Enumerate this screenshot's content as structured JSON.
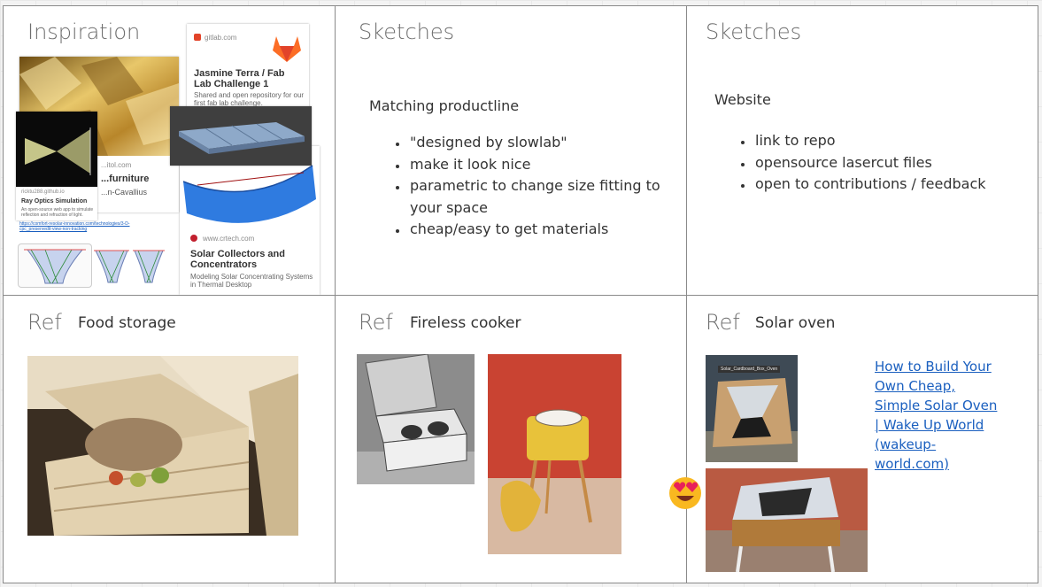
{
  "cells": {
    "inspiration": {
      "title": "Inspiration",
      "gitlab_card": {
        "source": "gitlab.com",
        "title": "Jasmine Terra / Fab Lab Challenge 1",
        "desc": "Shared and open repository for our first fab lab challenge."
      },
      "furniture_card": {
        "source": "...itol.com",
        "title": "...furniture",
        "author": "...n-Cavallius"
      },
      "ray_card": {
        "source": "ricktu288.github.io",
        "title": "Ray Optics Simulation",
        "desc": "An open-source web app to simulate reflection and refraction of light."
      },
      "crtech_card": {
        "source": "www.crtech.com",
        "title": "Solar Collectors and Concentrators",
        "desc": "Modeling Solar Concentrating Systems in Thermal Desktop"
      },
      "small_link": "https://comfort-resolar-innovation.com/technologies/3-D-cpc_preservedit-view-non-tracking"
    },
    "sketches1": {
      "title": "Sketches",
      "heading": "Matching productline",
      "bullets": [
        "\"designed by slowlab\"",
        "make it look nice",
        "parametric to change size fitting to your space",
        "cheap/easy to get materials"
      ]
    },
    "sketches2": {
      "title": "Sketches",
      "heading": "Website",
      "bullets": [
        "link to repo",
        "opensource lasercut files",
        "open to contributions / feedback"
      ]
    },
    "ref1": {
      "title": "Ref",
      "subtitle": "Food storage"
    },
    "ref2": {
      "title": "Ref",
      "subtitle": "Fireless cooker"
    },
    "ref3": {
      "title": "Ref",
      "subtitle": "Solar oven",
      "link_text": "How to Build Your Own Cheap, Simple Solar Oven | Wake Up World (wakeup-world.com)",
      "photo_label": "Solar_Cardboard_Box_Oven"
    }
  },
  "colors": {
    "link": "#1a5fbf",
    "border": "#8a8a8a",
    "title": "#6e6e6e",
    "emoji": "#f9b820"
  },
  "icons": {
    "gitlab": "gitlab-fox-icon",
    "crtech": "crtech-logo-icon",
    "emoji": "heart-eyes-emoji"
  }
}
